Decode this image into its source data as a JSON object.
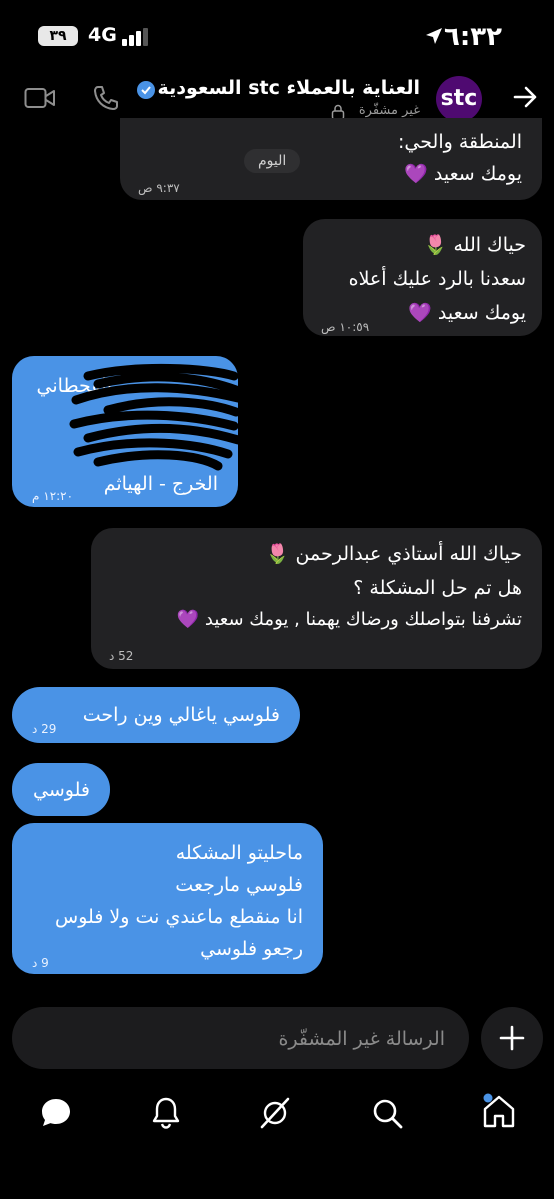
{
  "status_bar": {
    "time": "٦:٣٢",
    "network": "4G",
    "battery": "٣٩"
  },
  "header": {
    "title": "العناية بالعملاء stc السعودية",
    "subtitle": "غير مشفّرة",
    "avatar_text": "stc",
    "icons": [
      "back-arrow-icon",
      "phone-icon",
      "video-icon",
      "verified-icon",
      "lock-icon"
    ]
  },
  "day_chip": "اليوم",
  "messages": [
    {
      "side": "gray",
      "lines": [
        "المنطقة والحي:",
        "يومك سعيد 💜"
      ],
      "time": "٩:٣٧ ص"
    },
    {
      "side": "gray",
      "lines": [
        "حياك الله 🌷",
        "سعدنا بالرد عليك أعلاه",
        "يومك سعيد 💜"
      ],
      "time": "١٠:٥٩ ص"
    },
    {
      "side": "blue",
      "lines": [
        "القحطاني",
        "الخرج - الهياثم"
      ],
      "time": "١٢:٢٠ م"
    },
    {
      "side": "gray",
      "lines": [
        "حياك الله أستاذي عبدالرحمن 🌷",
        "هل تم حل المشكلة ؟",
        "تشرفنا بتواصلك ورضاك يهمنا , يومك سعيد 💜"
      ],
      "time": "52 د"
    },
    {
      "side": "blue",
      "lines": [
        "فلوسي ياغالي وين راحت"
      ],
      "time": "29 د"
    },
    {
      "side": "blue",
      "lines": [
        "فلوسي"
      ],
      "time": ""
    },
    {
      "side": "blue",
      "lines": [
        "ماحليتو المشكله",
        "فلوسي مارجعت",
        "انا منقطع ماعندي نت ولا فلوس",
        "رجعو فلوسي"
      ],
      "time": "9 د"
    }
  ],
  "composer": {
    "placeholder": "الرسالة غير المشفّرة"
  },
  "bottom_nav": [
    "home-icon",
    "search-icon",
    "grok-icon",
    "notifications-icon",
    "messages-icon"
  ],
  "colors": {
    "accent": "#4a93e6",
    "incoming": "#222224",
    "brand": "#4f0a71"
  }
}
